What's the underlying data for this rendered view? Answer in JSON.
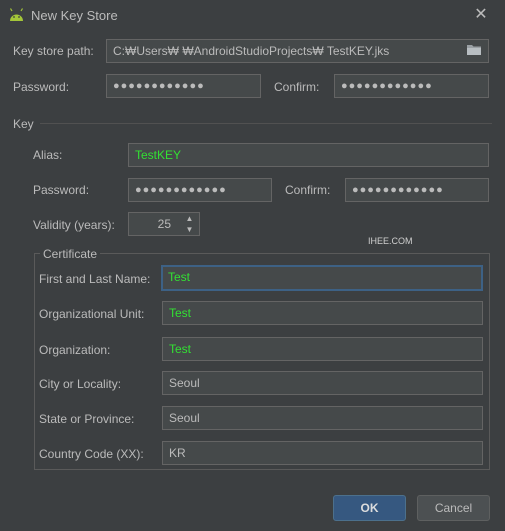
{
  "window": {
    "title": "New Key Store",
    "close_glyph": "✕"
  },
  "keystore": {
    "path_label": "Key store path:",
    "path_value": "C:₩Users₩        ₩AndroidStudioProjects₩   TestKEY.jks",
    "password_label": "Password:",
    "password_value": "●●●●●●●●●●●●",
    "confirm_label": "Confirm:",
    "confirm_value": "●●●●●●●●●●●●"
  },
  "key": {
    "section_label": "Key",
    "alias_label": "Alias:",
    "alias_value": "TestKEY",
    "password_label": "Password:",
    "password_value": "●●●●●●●●●●●●",
    "confirm_label": "Confirm:",
    "confirm_value": "●●●●●●●●●●●●",
    "validity_label": "Validity (years):",
    "validity_value": "25"
  },
  "watermark": "IHEE.COM",
  "certificate": {
    "group_label": "Certificate",
    "fields": [
      {
        "label": "First and Last Name:",
        "value": "Test"
      },
      {
        "label": "Organizational Unit:",
        "value": "Test"
      },
      {
        "label": "Organization:",
        "value": "Test"
      },
      {
        "label": "City or Locality:",
        "value": "Seoul"
      },
      {
        "label": "State or Province:",
        "value": "Seoul"
      },
      {
        "label": "Country Code (XX):",
        "value": "KR"
      }
    ]
  },
  "buttons": {
    "ok": "OK",
    "cancel": "Cancel"
  },
  "icons": {
    "app": "android-icon",
    "browse": "folder-icon",
    "close": "close-icon"
  },
  "colors": {
    "background": "#3c3f41",
    "field": "#45494a",
    "accent": "#365880",
    "green_text": "#33e033"
  }
}
